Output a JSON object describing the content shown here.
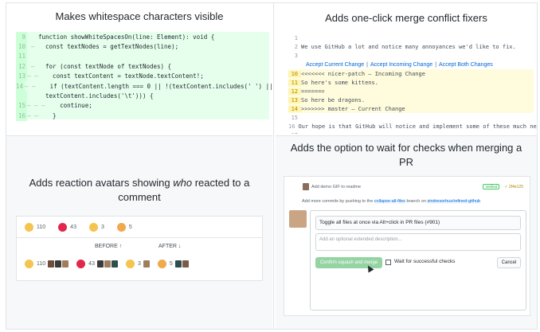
{
  "features": {
    "whitespace": {
      "title": "Makes whitespace characters visible",
      "lines": [
        {
          "n": "9",
          "m": "",
          "code": "function showWhiteSpacesOn(line: Element): void {"
        },
        {
          "n": "10",
          "m": "—",
          "code": "  const textNodes = getTextNodes(line);"
        },
        {
          "n": "11",
          "m": "",
          "code": ""
        },
        {
          "n": "12",
          "m": "—",
          "code": "  for (const textNode of textNodes) {"
        },
        {
          "n": "13",
          "m": "— —",
          "code": "    const textContent = textNode.textContent!;"
        },
        {
          "n": "14",
          "m": "— —",
          "code": "    if (textContent.length === 0 || !(textContent.includes(' ') ||"
        },
        {
          "n": "",
          "m": "",
          "code": "  textContent.includes('\\t'))) {"
        },
        {
          "n": "15",
          "m": "— — —",
          "code": "      continue;"
        },
        {
          "n": "16",
          "m": "— —",
          "code": "    }"
        }
      ]
    },
    "conflict": {
      "title": "Adds one-click merge conflict fixers",
      "fix_accept_current": "Accept Current Change",
      "fix_accept_incoming": "Accept Incoming Change",
      "fix_accept_both": "Accept Both Changes",
      "sep": "|",
      "lines_before": [
        {
          "n": "1",
          "t": "",
          "hl": false
        },
        {
          "n": "2",
          "t": "We use GitHub a lot and notice many annoyances we'd like to fix.",
          "hl": false
        },
        {
          "n": "3",
          "t": "",
          "hl": false
        }
      ],
      "lines_after": [
        {
          "n": "10",
          "t": "<<<<<<< nicer-patch — Incoming Change",
          "hl": true
        },
        {
          "n": "11",
          "t": "So here's some kittens.",
          "hl": true
        },
        {
          "n": "12",
          "t": "=======",
          "hl": true
        },
        {
          "n": "13",
          "t": "So here be dragons.",
          "hl": true
        },
        {
          "n": "14",
          "t": ">>>>>>> master — Current Change",
          "hl": true
        },
        {
          "n": "15",
          "t": "",
          "hl": false
        },
        {
          "n": "16",
          "t": "Our hope is that GitHub will notice and implement some of these much needed",
          "hl": false
        },
        {
          "n": "17",
          "t": "",
          "hl": false
        }
      ]
    },
    "reactions": {
      "title_pre": "Adds reaction avatars showing ",
      "title_em": "who",
      "title_post": " reacted to a comment",
      "before_label": "BEFORE ↑",
      "after_label": "AFTER ↓",
      "items": [
        {
          "emoji": "thumbs-up",
          "color": "#f5c34f",
          "count": "110"
        },
        {
          "emoji": "heart",
          "color": "#e2264d",
          "count": "43"
        },
        {
          "emoji": "smile",
          "color": "#f5c34f",
          "count": "3"
        },
        {
          "emoji": "tada",
          "color": "#f0a94b",
          "count": "5"
        }
      ]
    },
    "merge": {
      "title": "Adds the option to wait for checks when merging a PR",
      "commit_msg": "Add demo GIF to readme",
      "verified": "Verified",
      "sha": "✓ 2f4e125",
      "add_more_pre": "Add more commits by pushing to the ",
      "branch": "collapse-all-files",
      "add_more_mid": " branch on ",
      "repo": "sindresorhus/refined-github",
      "pr_title": "Toggle all files at once via Alt+click in PR files (#901)",
      "desc_placeholder": "Add an optional extended description...",
      "confirm_label": "Confirm squash and merge",
      "wait_label": "Wait for successful checks",
      "cancel_label": "Cancel"
    }
  }
}
